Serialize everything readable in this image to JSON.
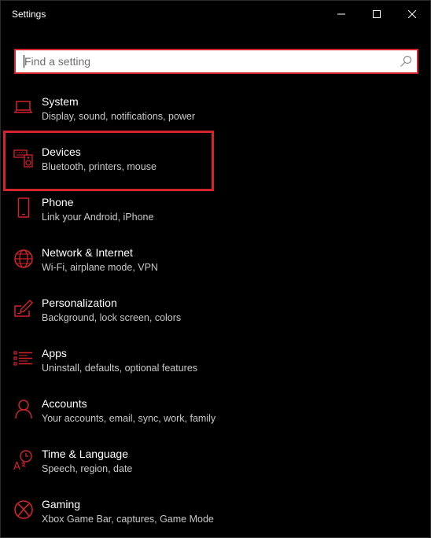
{
  "window": {
    "title": "Settings",
    "controls": {
      "minimize_icon": "minimize-icon",
      "maximize_icon": "maximize-icon",
      "close_icon": "close-icon"
    }
  },
  "search": {
    "placeholder": "Find a setting",
    "value": "",
    "icon": "search-icon"
  },
  "categories": [
    {
      "title": "System",
      "description": "Display, sound, notifications, power",
      "icon": "laptop-icon"
    },
    {
      "title": "Devices",
      "description": "Bluetooth, printers, mouse",
      "icon": "keyboard-speaker-icon"
    },
    {
      "title": "Phone",
      "description": "Link your Android, iPhone",
      "icon": "phone-icon"
    },
    {
      "title": "Network & Internet",
      "description": "Wi-Fi, airplane mode, VPN",
      "icon": "globe-icon"
    },
    {
      "title": "Personalization",
      "description": "Background, lock screen, colors",
      "icon": "pen-tablet-icon"
    },
    {
      "title": "Apps",
      "description": "Uninstall, defaults, optional features",
      "icon": "apps-list-icon"
    },
    {
      "title": "Accounts",
      "description": "Your accounts, email, sync, work, family",
      "icon": "person-icon"
    },
    {
      "title": "Time & Language",
      "description": "Speech, region, date",
      "icon": "time-language-icon"
    },
    {
      "title": "Gaming",
      "description": "Xbox Game Bar, captures, Game Mode",
      "icon": "xbox-icon"
    }
  ],
  "colors": {
    "accent": "#d3232b",
    "background": "#000000",
    "text_primary": "#ffffff",
    "text_secondary": "#c8c8c8"
  }
}
